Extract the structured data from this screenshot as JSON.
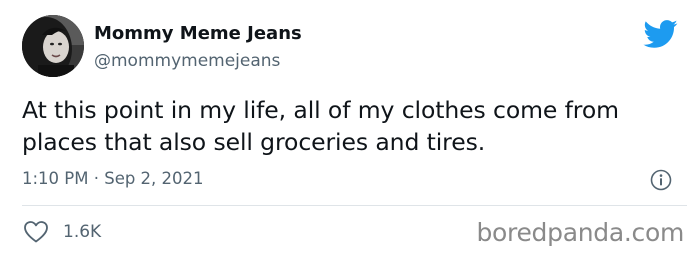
{
  "author": {
    "display_name": "Mommy Meme Jeans",
    "handle": "@mommymemejeans"
  },
  "tweet": {
    "text": "At this point in my life, all of my clothes come from places that also sell groceries and tires.",
    "timestamp": "1:10 PM · Sep 2, 2021"
  },
  "stats": {
    "likes": "1.6K"
  },
  "watermark": "boredpanda.com",
  "colors": {
    "brand_blue": "#1d9bf0",
    "text_primary": "#0f1419",
    "text_secondary": "#536471",
    "divider": "#dfe4e8",
    "watermark": "#8a8a8a"
  },
  "icons": {
    "brand": "twitter-bird-icon",
    "info": "info-icon",
    "like": "heart-icon"
  }
}
